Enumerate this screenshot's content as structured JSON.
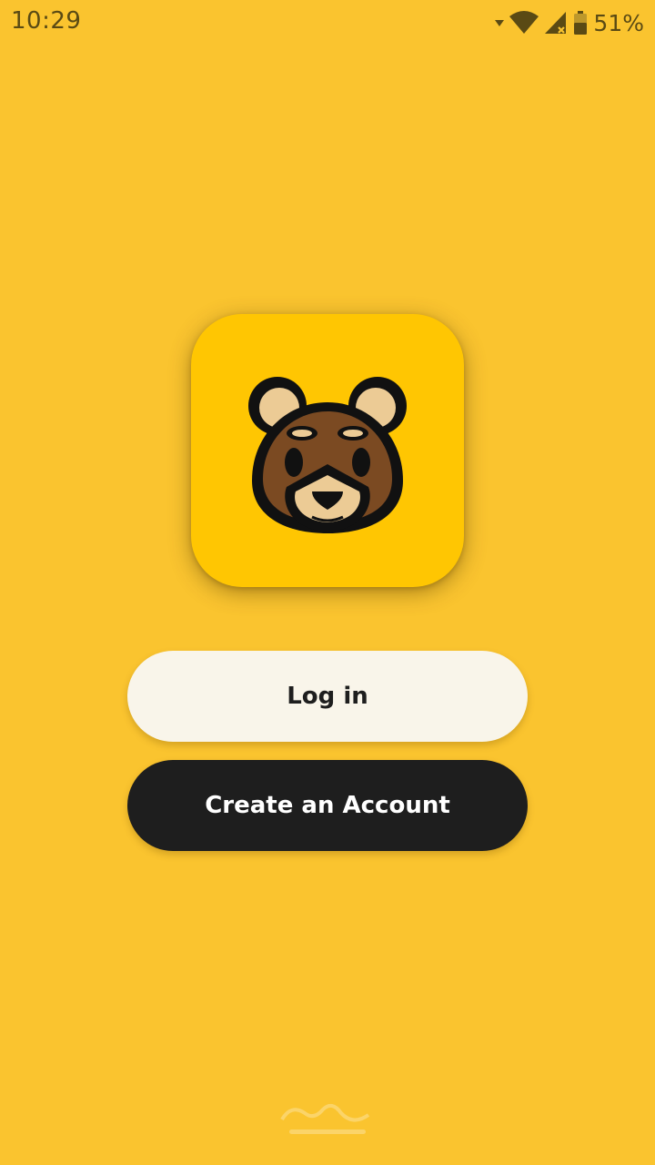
{
  "status_bar": {
    "time": "10:29",
    "battery_percent": "51%",
    "icons": [
      "wifi-icon",
      "signal-icon",
      "battery-icon"
    ]
  },
  "app": {
    "icon": "bear-logo-icon",
    "icon_background": "#FFC602",
    "background": "#FAC42F"
  },
  "actions": {
    "login_label": "Log in",
    "create_account_label": "Create an Account"
  },
  "colors": {
    "login_bg": "#F9F5EA",
    "create_bg": "#1E1E1E",
    "bear_fur": "#7B4A22",
    "bear_muzzle": "#ECCB95"
  }
}
